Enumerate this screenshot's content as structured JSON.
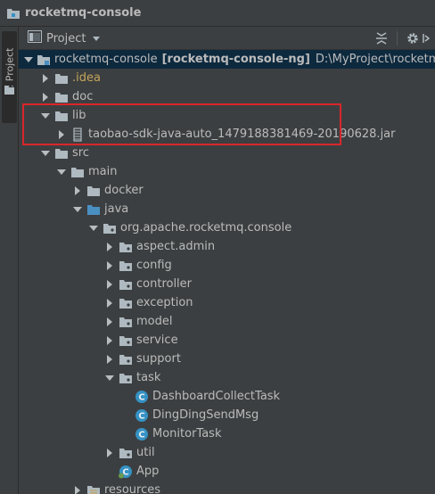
{
  "window": {
    "title": "rocketmq-console"
  },
  "side_tab": {
    "label": "1: Project"
  },
  "panel": {
    "view_label": "Project"
  },
  "tree": [
    {
      "label": "rocketmq-console",
      "bold_suffix": "[rocketmq-console-ng]",
      "path": "D:\\MyProject\\rocketmq-exter",
      "depth": 0,
      "expanded": true,
      "icon": "module-folder-icon",
      "selected": true
    },
    {
      "label": ".idea",
      "depth": 1,
      "expanded": false,
      "icon": "folder-icon",
      "style": "idea"
    },
    {
      "label": "doc",
      "depth": 1,
      "expanded": false,
      "icon": "folder-icon"
    },
    {
      "label": "lib",
      "depth": 1,
      "expanded": true,
      "icon": "folder-icon"
    },
    {
      "label": "taobao-sdk-java-auto_1479188381469-20190628.jar",
      "depth": 2,
      "expanded": false,
      "icon": "jar-icon"
    },
    {
      "label": "src",
      "depth": 1,
      "expanded": true,
      "icon": "folder-icon"
    },
    {
      "label": "main",
      "depth": 2,
      "expanded": true,
      "icon": "folder-icon"
    },
    {
      "label": "docker",
      "depth": 3,
      "expanded": false,
      "icon": "folder-icon"
    },
    {
      "label": "java",
      "depth": 3,
      "expanded": true,
      "icon": "source-folder-icon"
    },
    {
      "label": "org.apache.rocketmq.console",
      "depth": 4,
      "expanded": true,
      "icon": "package-icon"
    },
    {
      "label": "aspect.admin",
      "depth": 5,
      "expanded": false,
      "icon": "package-icon"
    },
    {
      "label": "config",
      "depth": 5,
      "expanded": false,
      "icon": "package-icon"
    },
    {
      "label": "controller",
      "depth": 5,
      "expanded": false,
      "icon": "package-icon"
    },
    {
      "label": "exception",
      "depth": 5,
      "expanded": false,
      "icon": "package-icon"
    },
    {
      "label": "model",
      "depth": 5,
      "expanded": false,
      "icon": "package-icon"
    },
    {
      "label": "service",
      "depth": 5,
      "expanded": false,
      "icon": "package-icon"
    },
    {
      "label": "support",
      "depth": 5,
      "expanded": false,
      "icon": "package-icon"
    },
    {
      "label": "task",
      "depth": 5,
      "expanded": true,
      "icon": "package-icon"
    },
    {
      "label": "DashboardCollectTask",
      "depth": 6,
      "icon": "class-icon"
    },
    {
      "label": "DingDingSendMsg",
      "depth": 6,
      "icon": "class-icon"
    },
    {
      "label": "MonitorTask",
      "depth": 6,
      "icon": "class-icon"
    },
    {
      "label": "util",
      "depth": 5,
      "expanded": false,
      "icon": "package-icon"
    },
    {
      "label": "App",
      "depth": 5,
      "icon": "spring-class-icon"
    },
    {
      "label": "resources",
      "depth": 3,
      "expanded": false,
      "icon": "resources-folder-icon"
    }
  ],
  "colors": {
    "background": "#3c3f41",
    "selection": "#0d293e",
    "text": "#bbbbbb",
    "excluded_text": "#c4a55a",
    "annotation_box": "#d9262a",
    "folder": "#aeb9c0",
    "source_folder": "#4a8fc2",
    "class_icon": "#3592c4"
  }
}
